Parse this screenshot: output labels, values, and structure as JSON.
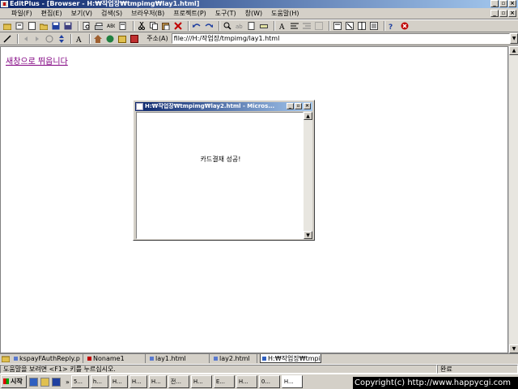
{
  "window": {
    "title": "EditPlus - [Browser - H:₩작업장₩tmpimg₩lay1.html]",
    "minimize": "_",
    "restore": "▫",
    "close": "×"
  },
  "menu": [
    "파일(F)",
    "편집(E)",
    "보기(V)",
    "검색(S)",
    "브라우저(B)",
    "프로젝트(P)",
    "도구(T)",
    "창(W)",
    "도움말(H)"
  ],
  "address": {
    "label": "주소(A)",
    "value": "file:///H:/작업장/tmpimg/lay1.html"
  },
  "page": {
    "link_text": "새창으로 뛰웁니다"
  },
  "popup": {
    "title": "H:₩작업장₩tmpimg₩lay2.html - Micros...",
    "message": "카드결재 성공!"
  },
  "tabs": [
    {
      "label": "kspayFAuthReply.p",
      "color": "#5a7ad0"
    },
    {
      "label": "Noname1",
      "color": "#c00000"
    },
    {
      "label": "lay1.html",
      "color": "#5a7ad0"
    },
    {
      "label": "lay2.html",
      "color": "#5a7ad0"
    },
    {
      "label": "H:₩작업장₩tmpim",
      "color": "#3060c0"
    }
  ],
  "status": {
    "help": "도움말을 보려면 <F1> 키를 누르십시오.",
    "done": "완료"
  },
  "taskbar": {
    "start": "시작",
    "tasks": [
      "5...",
      "h...",
      "H...",
      "H...",
      "H...",
      "전...",
      "H...",
      "E...",
      "H...",
      "0...",
      "H..."
    ],
    "copyright": "Copyright(c) http://www.happycgi.com"
  }
}
